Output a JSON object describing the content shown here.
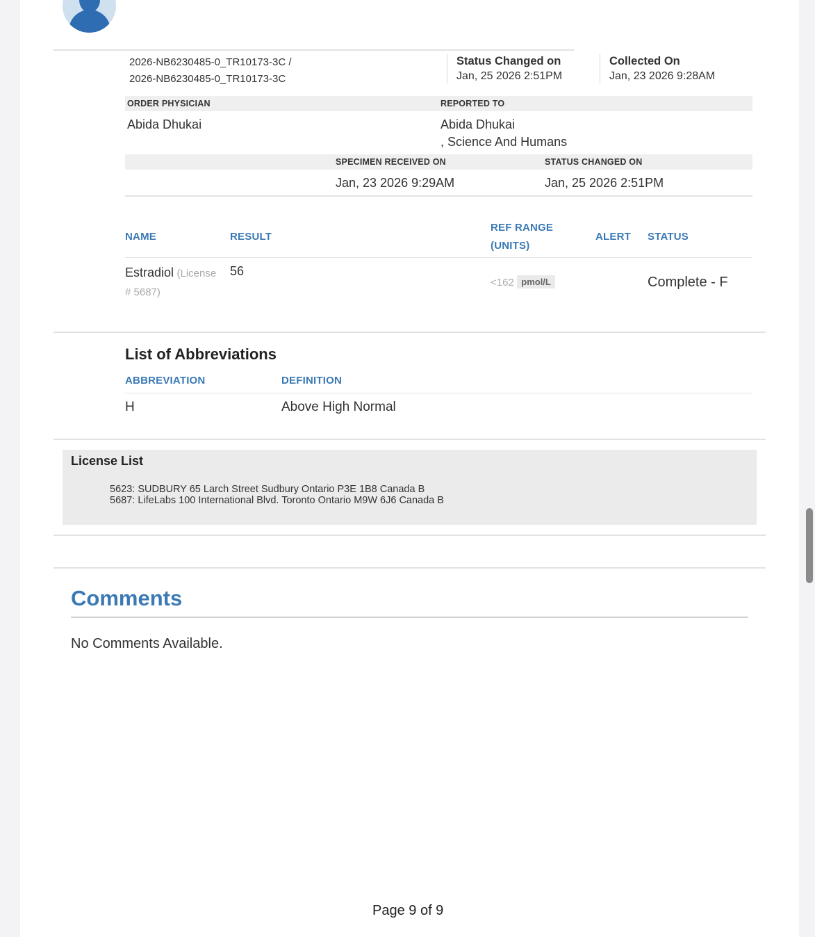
{
  "header": {
    "accession_line1": "2026-NB6230485-0_TR10173-3C /",
    "accession_line2": "2026-NB6230485-0_TR10173-3C",
    "status_changed_label": "Status Changed on",
    "status_changed_value": "Jan, 25 2026 2:51PM",
    "collected_label": "Collected On",
    "collected_value": "Jan, 23 2026 9:28AM"
  },
  "physician": {
    "order_label": "ORDER PHYSICIAN",
    "order_value": "Abida Dhukai",
    "reported_label": "REPORTED TO",
    "reported_line1": "Abida Dhukai",
    "reported_line2": ", Science And Humans"
  },
  "specimen": {
    "received_label": "SPECIMEN RECEIVED ON",
    "received_value": "Jan, 23 2026 9:29AM",
    "status_label": "STATUS CHANGED ON",
    "status_value": "Jan, 25 2026 2:51PM"
  },
  "results": {
    "headers": {
      "name": "NAME",
      "result": "RESULT",
      "ref_range_1": "REF RANGE",
      "ref_range_2": "(UNITS)",
      "alert": "ALERT",
      "status": "STATUS"
    },
    "rows": [
      {
        "name": "Estradiol",
        "license_1": "(License",
        "license_2": "# 5687)",
        "result": "56",
        "ref": "<162",
        "units": "pmol/L",
        "alert": "",
        "status": "Complete - F"
      }
    ]
  },
  "abbreviations": {
    "title": "List of Abbreviations",
    "col_abbr": "ABBREVIATION",
    "col_def": "DEFINITION",
    "rows": [
      {
        "abbr": "H",
        "def": "Above High Normal"
      }
    ]
  },
  "license_list": {
    "title": "License List",
    "lines": [
      "5623: SUDBURY 65 Larch Street Sudbury Ontario P3E 1B8 Canada B",
      "5687: LifeLabs 100 International Blvd. Toronto Ontario M9W 6J6 Canada B"
    ]
  },
  "comments": {
    "title": "Comments",
    "text": "No Comments Available."
  },
  "footer": {
    "page": "Page 9 of 9"
  }
}
